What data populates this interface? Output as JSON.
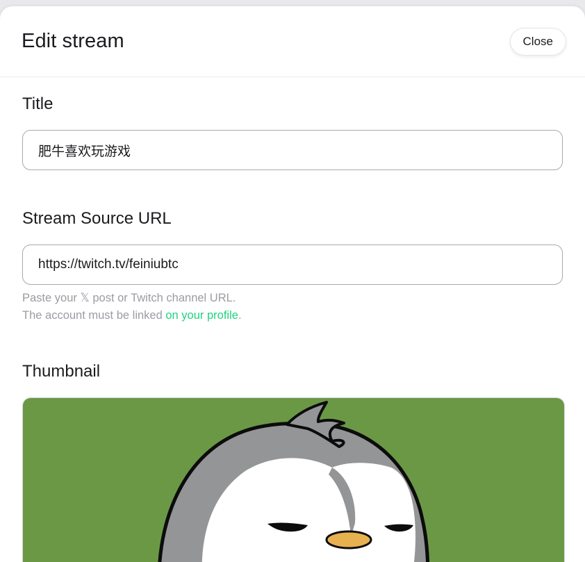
{
  "header": {
    "title": "Edit stream",
    "close_label": "Close"
  },
  "title_section": {
    "label": "Title",
    "value": "肥牛喜欢玩游戏"
  },
  "source_section": {
    "label": "Stream Source URL",
    "value": "https://twitch.tv/feiniubtc",
    "hint_line1": "Paste your 𝕏 post or Twitch channel URL.",
    "hint_line2_prefix": "The account must be linked ",
    "hint_link": "on your profile",
    "hint_line2_suffix": "."
  },
  "thumbnail_section": {
    "label": "Thumbnail"
  },
  "colors": {
    "accent": "#1ed47e",
    "thumb_bg": "#6b9845",
    "penguin_gray": "#939596",
    "beak": "#e8b150"
  }
}
